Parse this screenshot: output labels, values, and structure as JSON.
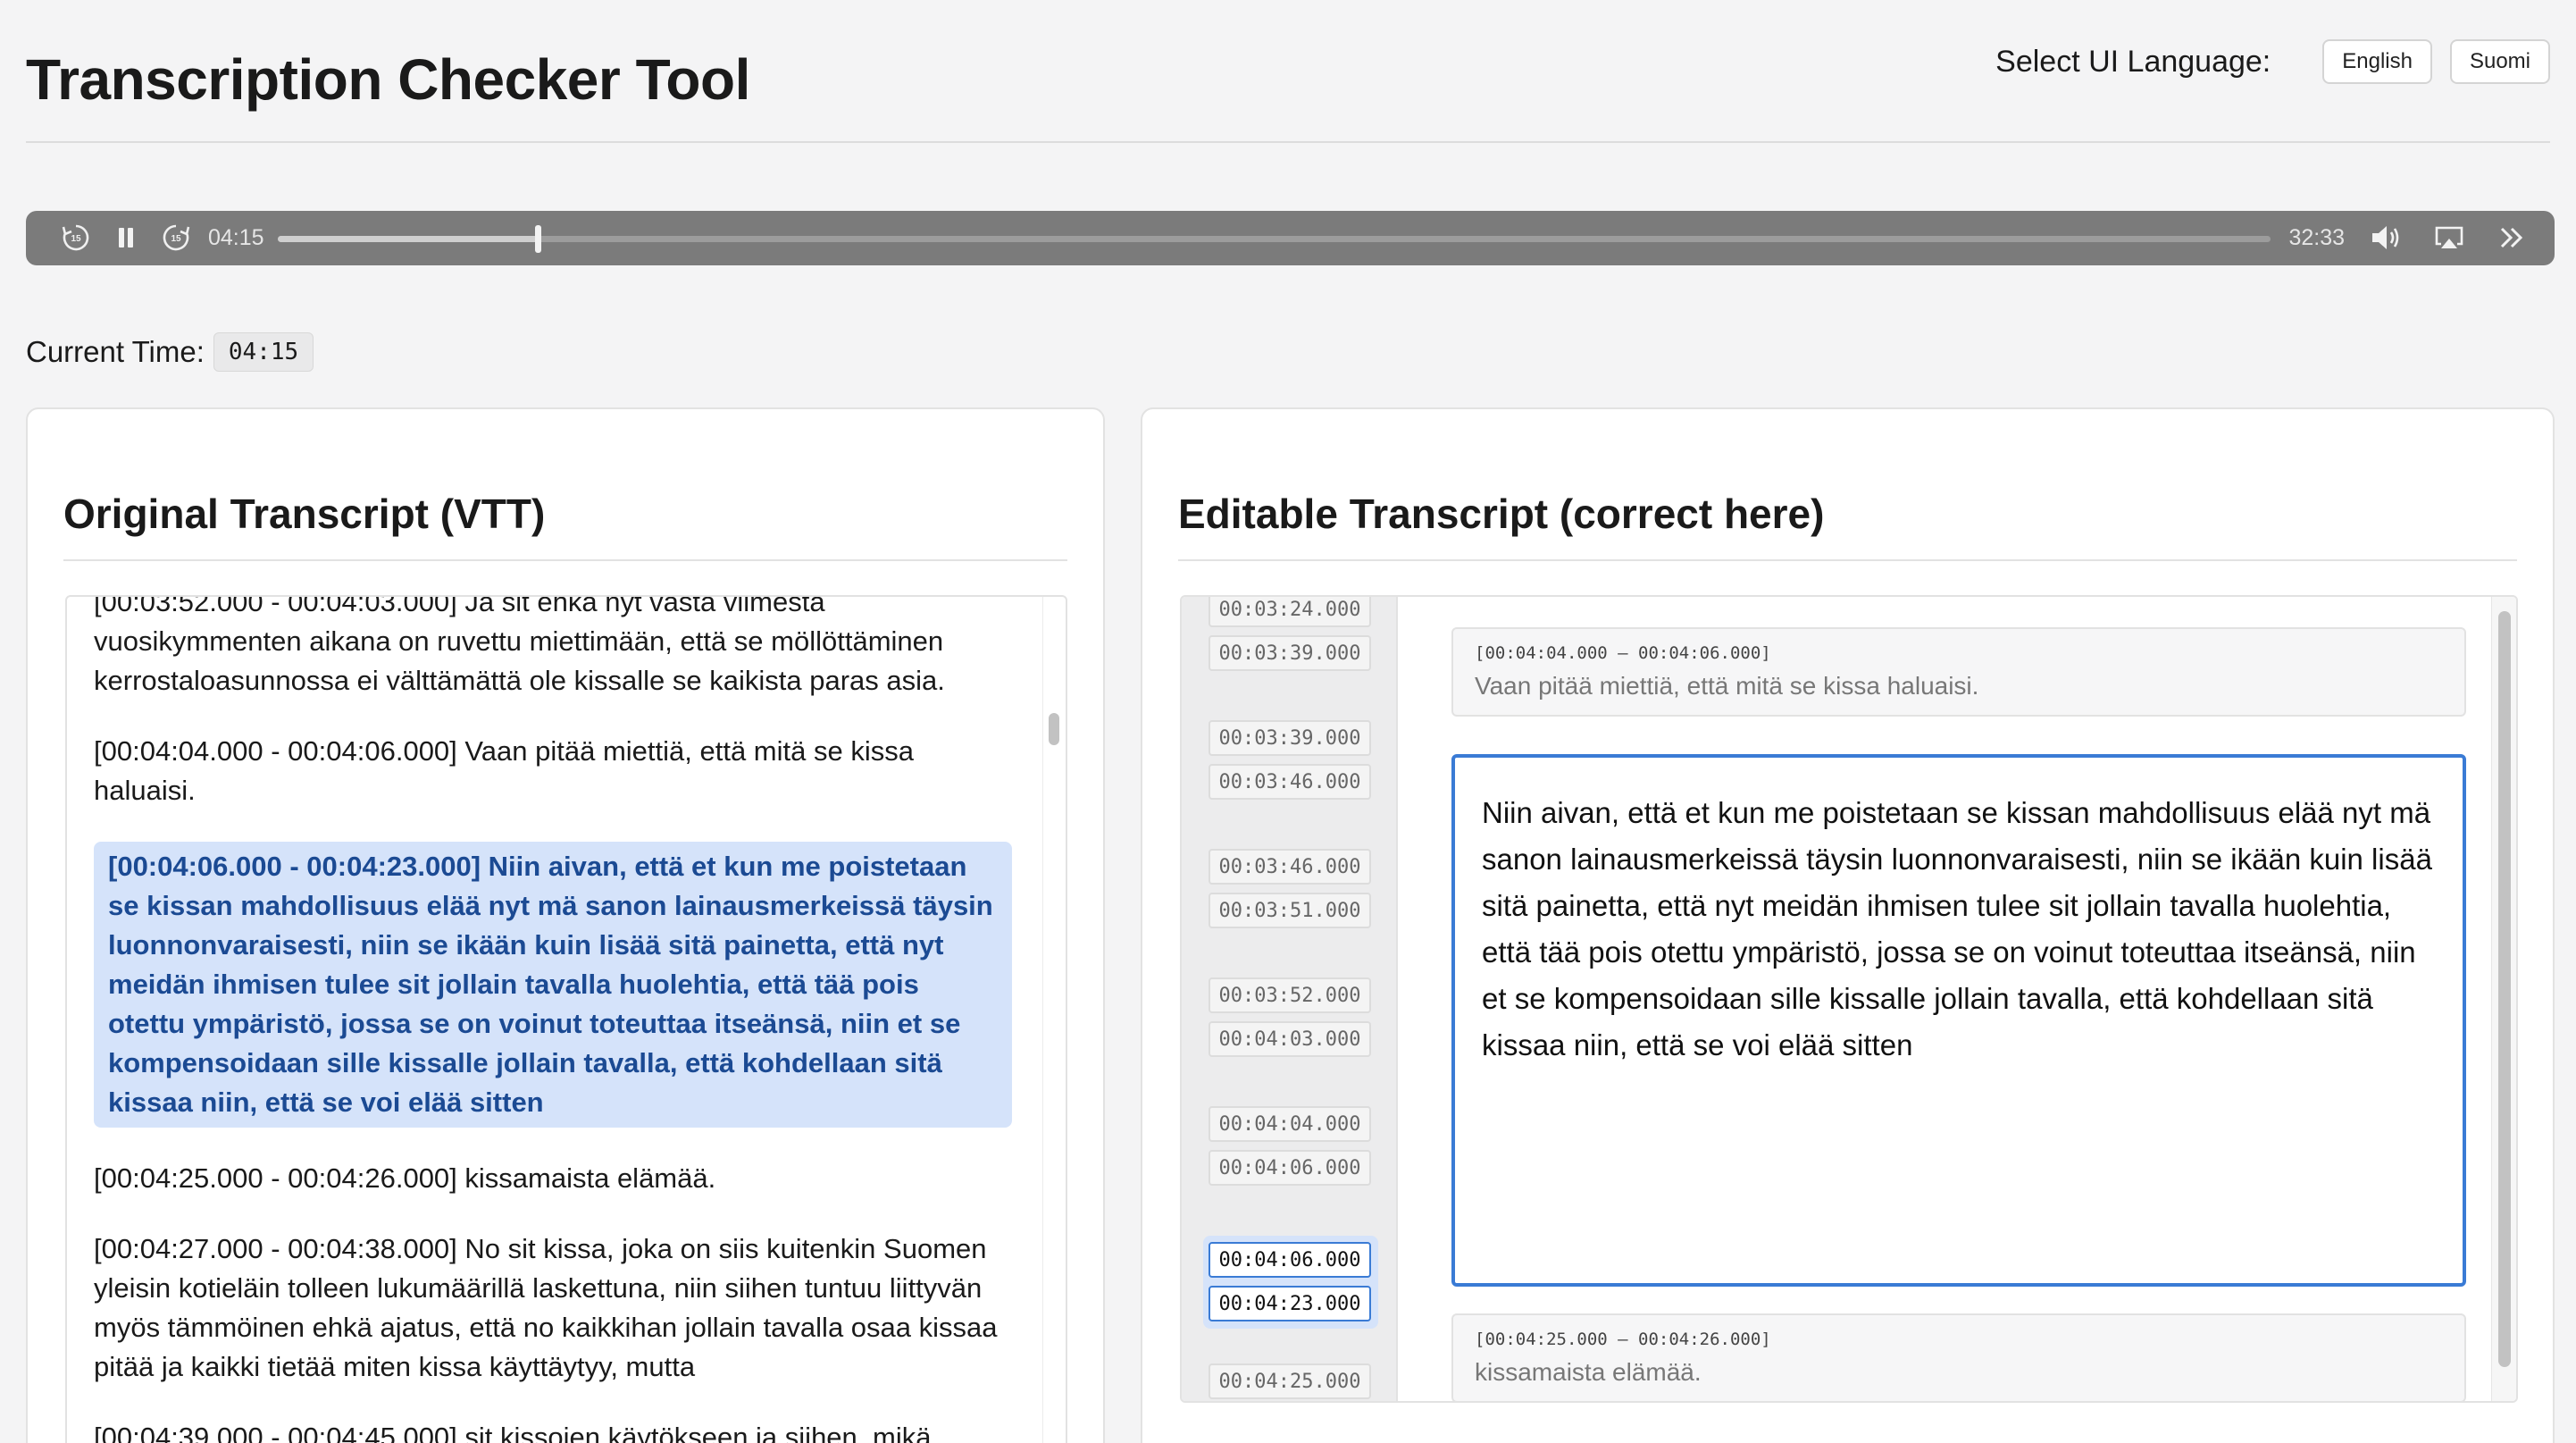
{
  "app": {
    "title": "Transcription Checker Tool"
  },
  "language": {
    "label": "Select UI Language:",
    "options": [
      "English",
      "Suomi"
    ]
  },
  "player": {
    "current": "04:15",
    "duration": "32:33",
    "progress": 0.1306,
    "skip_back": "15",
    "skip_forward": "15"
  },
  "current_time": {
    "label": "Current Time:",
    "value": "04:15"
  },
  "original": {
    "title": "Original Transcript (VTT)",
    "cues": [
      {
        "text": "[00:03:52.000 - 00:04:03.000] Ja sit ehkä nyt vasta viimestä vuosikymmenten aikana on ruvettu miettimään, että se möllöttäminen kerrostaloasunnossa ei välttämättä ole kissalle se kaikista paras asia."
      },
      {
        "text": "[00:04:04.000 - 00:04:06.000] Vaan pitää miettiä, että mitä se kissa haluaisi."
      },
      {
        "text": "[00:04:06.000 - 00:04:23.000] Niin aivan, että et kun me poistetaan se kissan mahdollisuus elää nyt mä sanon lainausmerkeissä täysin luonnonvaraisesti, niin se ikään kuin lisää sitä painetta, että nyt meidän ihmisen tulee sit jollain tavalla huolehtia, että tää pois otettu ympäristö, jossa se on voinut toteuttaa itseänsä, niin et se kompensoidaan sille kissalle jollain tavalla, että kohdellaan sitä kissaa niin, että se voi elää sitten"
      },
      {
        "text": "[00:04:25.000 - 00:04:26.000] kissamaista elämää."
      },
      {
        "text": "[00:04:27.000 - 00:04:38.000] No sit kissa, joka on siis kuitenkin Suomen yleisin kotieläin tolleen lukumäärillä laskettuna, niin siihen tuntuu liittyvän myös tämmöinen ehkä ajatus, että no kaikkihan jollain tavalla osaa kissaa pitää ja kaikki tietää miten kissa käyttäytyy, mutta"
      },
      {
        "text": "[00:04:39.000 - 00:04:45.000] sit kissojen käytökseen ja siihen, mikä"
      }
    ]
  },
  "editable": {
    "title": "Editable Transcript (correct here)",
    "timestamps": [
      "00:03:24.000",
      "00:03:39.000",
      "00:03:39.000",
      "00:03:46.000",
      "00:03:46.000",
      "00:03:51.000",
      "00:03:52.000",
      "00:04:03.000",
      "00:04:04.000",
      "00:04:06.000",
      "00:04:06.000",
      "00:04:23.000",
      "00:04:25.000"
    ],
    "prev_card": {
      "time": "[00:04:04.000 – 00:04:06.000]",
      "text": "Vaan pitää miettiä, että mitä se kissa haluaisi."
    },
    "active_text": "Niin aivan, että et kun me poistetaan se kissan mahdollisuus elää nyt mä sanon lainausmerkeissä täysin luonnonvaraisesti, niin se ikään kuin lisää sitä painetta, että nyt meidän ihmisen tulee sit jollain tavalla huolehtia, että tää pois otettu ympäristö, jossa se on voinut toteuttaa itseänsä, niin et se kompensoidaan sille kissalle jollain tavalla, että kohdellaan sitä kissaa niin, että se voi elää sitten",
    "next_card": {
      "time": "[00:04:25.000 – 00:04:26.000]",
      "text": "kissamaista elämää."
    }
  },
  "colors": {
    "accent": "#3a7bd5",
    "highlight_bg": "#d5e3fa",
    "highlight_text": "#1b4a93",
    "player_bg": "#7b7b7b"
  }
}
